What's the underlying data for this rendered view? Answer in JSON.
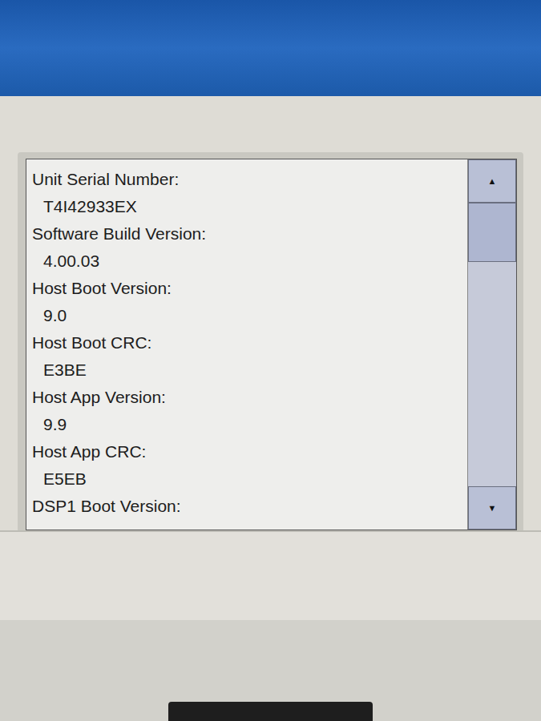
{
  "items": [
    {
      "label": "Unit Serial Number:",
      "value": "T4I42933EX"
    },
    {
      "label": "Software Build Version:",
      "value": "4.00.03"
    },
    {
      "label": "Host Boot Version:",
      "value": "9.0"
    },
    {
      "label": "Host Boot CRC:",
      "value": "E3BE"
    },
    {
      "label": "Host App Version:",
      "value": "9.9"
    },
    {
      "label": "Host App CRC:",
      "value": "E5EB"
    },
    {
      "label": "DSP1 Boot Version:"
    }
  ],
  "scrollbar": {
    "up": "▲",
    "down": "▼",
    "level": 0.21
  }
}
